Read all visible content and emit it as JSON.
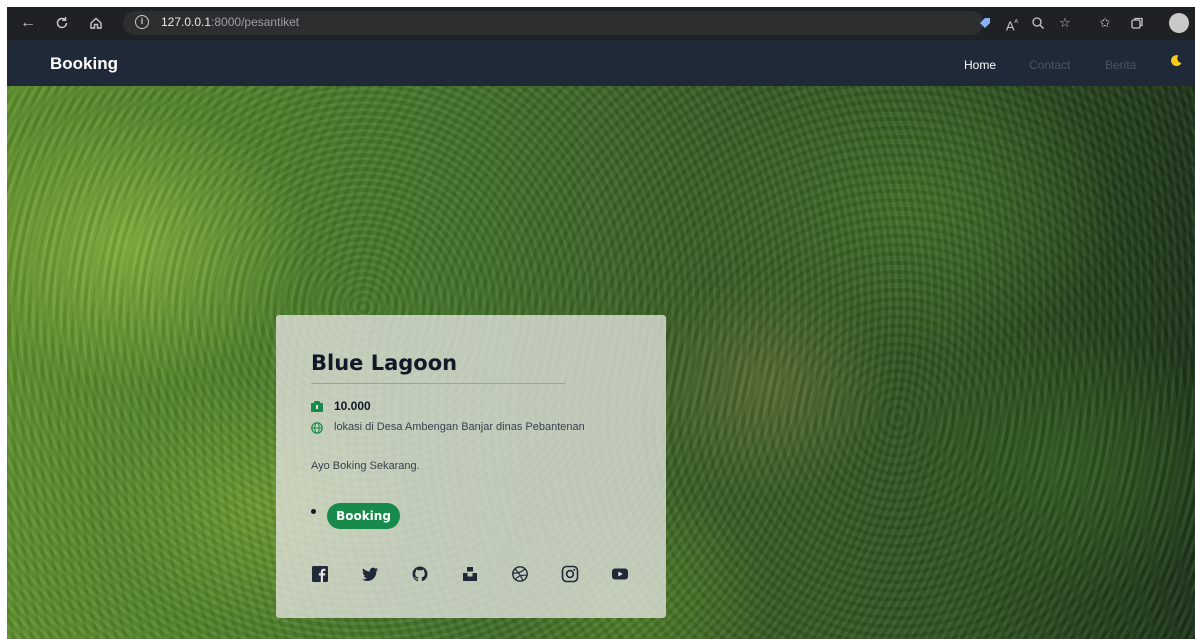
{
  "browser": {
    "url_host": "127.0.0.1",
    "url_rest": ":8000/pesantiket"
  },
  "navbar": {
    "brand": "Booking",
    "links": [
      {
        "label": "Home",
        "active": true
      },
      {
        "label": "Contact",
        "active": false
      },
      {
        "label": "Berita",
        "active": false
      }
    ]
  },
  "card": {
    "title": "Blue Lagoon",
    "price": "10.000",
    "location": "lokasi di Desa Ambengan Banjar dinas Pebantenan",
    "cta_text": "Ayo Boking Sekarang.",
    "button_label": "Booking",
    "social_icons": [
      "facebook-icon",
      "twitter-icon",
      "github-icon",
      "unsplash-icon",
      "dribbble-icon",
      "instagram-icon",
      "youtube-icon"
    ]
  },
  "colors": {
    "navbar_bg": "#1f2937",
    "accent": "#178a4c",
    "moon": "#facc15"
  }
}
